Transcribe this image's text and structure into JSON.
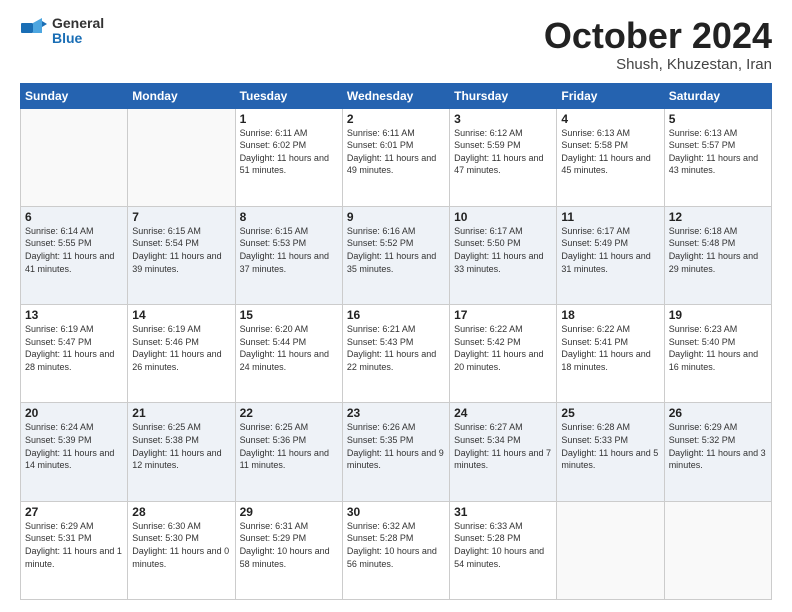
{
  "logo": {
    "general": "General",
    "blue": "Blue"
  },
  "title": "October 2024",
  "subtitle": "Shush, Khuzestan, Iran",
  "weekdays": [
    "Sunday",
    "Monday",
    "Tuesday",
    "Wednesday",
    "Thursday",
    "Friday",
    "Saturday"
  ],
  "weeks": [
    [
      {
        "day": "",
        "sunrise": "",
        "sunset": "",
        "daylight": ""
      },
      {
        "day": "",
        "sunrise": "",
        "sunset": "",
        "daylight": ""
      },
      {
        "day": "1",
        "sunrise": "Sunrise: 6:11 AM",
        "sunset": "Sunset: 6:02 PM",
        "daylight": "Daylight: 11 hours and 51 minutes."
      },
      {
        "day": "2",
        "sunrise": "Sunrise: 6:11 AM",
        "sunset": "Sunset: 6:01 PM",
        "daylight": "Daylight: 11 hours and 49 minutes."
      },
      {
        "day": "3",
        "sunrise": "Sunrise: 6:12 AM",
        "sunset": "Sunset: 5:59 PM",
        "daylight": "Daylight: 11 hours and 47 minutes."
      },
      {
        "day": "4",
        "sunrise": "Sunrise: 6:13 AM",
        "sunset": "Sunset: 5:58 PM",
        "daylight": "Daylight: 11 hours and 45 minutes."
      },
      {
        "day": "5",
        "sunrise": "Sunrise: 6:13 AM",
        "sunset": "Sunset: 5:57 PM",
        "daylight": "Daylight: 11 hours and 43 minutes."
      }
    ],
    [
      {
        "day": "6",
        "sunrise": "Sunrise: 6:14 AM",
        "sunset": "Sunset: 5:55 PM",
        "daylight": "Daylight: 11 hours and 41 minutes."
      },
      {
        "day": "7",
        "sunrise": "Sunrise: 6:15 AM",
        "sunset": "Sunset: 5:54 PM",
        "daylight": "Daylight: 11 hours and 39 minutes."
      },
      {
        "day": "8",
        "sunrise": "Sunrise: 6:15 AM",
        "sunset": "Sunset: 5:53 PM",
        "daylight": "Daylight: 11 hours and 37 minutes."
      },
      {
        "day": "9",
        "sunrise": "Sunrise: 6:16 AM",
        "sunset": "Sunset: 5:52 PM",
        "daylight": "Daylight: 11 hours and 35 minutes."
      },
      {
        "day": "10",
        "sunrise": "Sunrise: 6:17 AM",
        "sunset": "Sunset: 5:50 PM",
        "daylight": "Daylight: 11 hours and 33 minutes."
      },
      {
        "day": "11",
        "sunrise": "Sunrise: 6:17 AM",
        "sunset": "Sunset: 5:49 PM",
        "daylight": "Daylight: 11 hours and 31 minutes."
      },
      {
        "day": "12",
        "sunrise": "Sunrise: 6:18 AM",
        "sunset": "Sunset: 5:48 PM",
        "daylight": "Daylight: 11 hours and 29 minutes."
      }
    ],
    [
      {
        "day": "13",
        "sunrise": "Sunrise: 6:19 AM",
        "sunset": "Sunset: 5:47 PM",
        "daylight": "Daylight: 11 hours and 28 minutes."
      },
      {
        "day": "14",
        "sunrise": "Sunrise: 6:19 AM",
        "sunset": "Sunset: 5:46 PM",
        "daylight": "Daylight: 11 hours and 26 minutes."
      },
      {
        "day": "15",
        "sunrise": "Sunrise: 6:20 AM",
        "sunset": "Sunset: 5:44 PM",
        "daylight": "Daylight: 11 hours and 24 minutes."
      },
      {
        "day": "16",
        "sunrise": "Sunrise: 6:21 AM",
        "sunset": "Sunset: 5:43 PM",
        "daylight": "Daylight: 11 hours and 22 minutes."
      },
      {
        "day": "17",
        "sunrise": "Sunrise: 6:22 AM",
        "sunset": "Sunset: 5:42 PM",
        "daylight": "Daylight: 11 hours and 20 minutes."
      },
      {
        "day": "18",
        "sunrise": "Sunrise: 6:22 AM",
        "sunset": "Sunset: 5:41 PM",
        "daylight": "Daylight: 11 hours and 18 minutes."
      },
      {
        "day": "19",
        "sunrise": "Sunrise: 6:23 AM",
        "sunset": "Sunset: 5:40 PM",
        "daylight": "Daylight: 11 hours and 16 minutes."
      }
    ],
    [
      {
        "day": "20",
        "sunrise": "Sunrise: 6:24 AM",
        "sunset": "Sunset: 5:39 PM",
        "daylight": "Daylight: 11 hours and 14 minutes."
      },
      {
        "day": "21",
        "sunrise": "Sunrise: 6:25 AM",
        "sunset": "Sunset: 5:38 PM",
        "daylight": "Daylight: 11 hours and 12 minutes."
      },
      {
        "day": "22",
        "sunrise": "Sunrise: 6:25 AM",
        "sunset": "Sunset: 5:36 PM",
        "daylight": "Daylight: 11 hours and 11 minutes."
      },
      {
        "day": "23",
        "sunrise": "Sunrise: 6:26 AM",
        "sunset": "Sunset: 5:35 PM",
        "daylight": "Daylight: 11 hours and 9 minutes."
      },
      {
        "day": "24",
        "sunrise": "Sunrise: 6:27 AM",
        "sunset": "Sunset: 5:34 PM",
        "daylight": "Daylight: 11 hours and 7 minutes."
      },
      {
        "day": "25",
        "sunrise": "Sunrise: 6:28 AM",
        "sunset": "Sunset: 5:33 PM",
        "daylight": "Daylight: 11 hours and 5 minutes."
      },
      {
        "day": "26",
        "sunrise": "Sunrise: 6:29 AM",
        "sunset": "Sunset: 5:32 PM",
        "daylight": "Daylight: 11 hours and 3 minutes."
      }
    ],
    [
      {
        "day": "27",
        "sunrise": "Sunrise: 6:29 AM",
        "sunset": "Sunset: 5:31 PM",
        "daylight": "Daylight: 11 hours and 1 minute."
      },
      {
        "day": "28",
        "sunrise": "Sunrise: 6:30 AM",
        "sunset": "Sunset: 5:30 PM",
        "daylight": "Daylight: 11 hours and 0 minutes."
      },
      {
        "day": "29",
        "sunrise": "Sunrise: 6:31 AM",
        "sunset": "Sunset: 5:29 PM",
        "daylight": "Daylight: 10 hours and 58 minutes."
      },
      {
        "day": "30",
        "sunrise": "Sunrise: 6:32 AM",
        "sunset": "Sunset: 5:28 PM",
        "daylight": "Daylight: 10 hours and 56 minutes."
      },
      {
        "day": "31",
        "sunrise": "Sunrise: 6:33 AM",
        "sunset": "Sunset: 5:28 PM",
        "daylight": "Daylight: 10 hours and 54 minutes."
      },
      {
        "day": "",
        "sunrise": "",
        "sunset": "",
        "daylight": ""
      },
      {
        "day": "",
        "sunrise": "",
        "sunset": "",
        "daylight": ""
      }
    ]
  ]
}
